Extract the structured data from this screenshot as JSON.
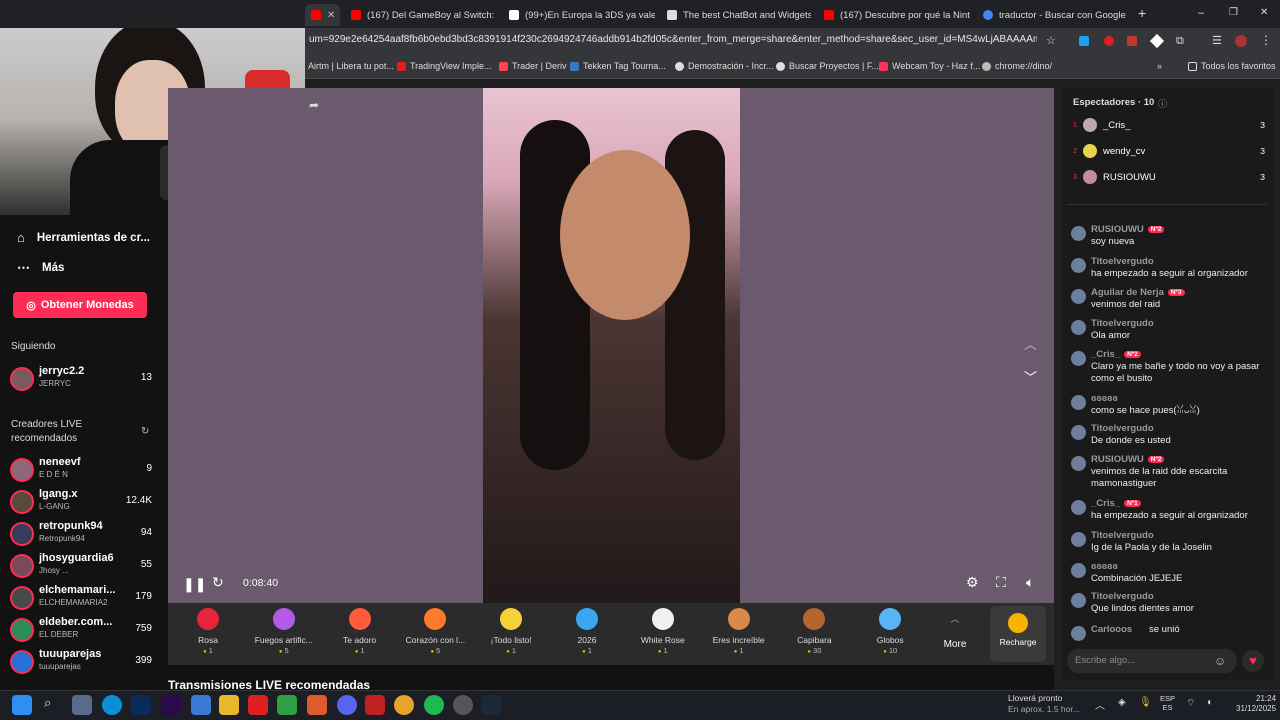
{
  "tabs": [
    {
      "label": "(167) Del GameBoy al Switch: L",
      "color": "#ff0000"
    },
    {
      "label": "(99+)En Europa la 3DS ya vale",
      "color": "#ffffff"
    },
    {
      "label": "The best ChatBot and Widgets",
      "color": "#dddddd"
    },
    {
      "label": "(167) Descubre por qué la Nint",
      "color": "#ff0000"
    },
    {
      "label": "traductor - Buscar con Google",
      "color": "#4285f4"
    }
  ],
  "new_tab": "+",
  "url": "um=929e2e64254aaf8fb6b0ebd3bd3c8391914f230c2694924746addb914b2fd05c&enter_from_merge=share&enter_method=share&sec_user_id=MS4wLjABAAAAmqRN1Wqw7...",
  "bookmarks": [
    {
      "label": "Airtm | Libera tu pot...",
      "color": "#4a6cf7"
    },
    {
      "label": "TradingView Imple...",
      "color": "#e02020"
    },
    {
      "label": "Trader | Deriv",
      "color": "#ff444f"
    },
    {
      "label": "Tekken Tag Tourna...",
      "color": "#3a78c2"
    },
    {
      "label": "Demostración - Incr...",
      "color": "#dddddd"
    },
    {
      "label": "Buscar Proyectos | F...",
      "color": "#dddddd"
    },
    {
      "label": "Webcam Toy - Haz f...",
      "color": "#ff3355"
    },
    {
      "label": "chrome://dino/",
      "color": "#bbbbbb"
    }
  ],
  "bookmarks_all": "Todos los favoritos",
  "sidebar": {
    "tools": "Herramientas de cr...",
    "more": "Más",
    "coins_button": "Obtener Monedas",
    "following_title": "Siguiendo",
    "following": [
      {
        "name": "jerryc2.2",
        "sub": "JERRYC",
        "count": "13"
      }
    ],
    "recommended_title_1": "Creadores LIVE",
    "recommended_title_2": "recomendados",
    "recommended": [
      {
        "name": "neneevf",
        "sub": "E D É N",
        "count": "9"
      },
      {
        "name": "lgang.x",
        "sub": "L-GANG",
        "count": "12.4K"
      },
      {
        "name": "retropunk94",
        "sub": "Retropunk94",
        "count": "94"
      },
      {
        "name": "jhosyguardia6",
        "sub": "Jhosy ...",
        "count": "55"
      },
      {
        "name": "elchemamari...",
        "sub": "ELCHEMAMARIA2",
        "count": "179"
      },
      {
        "name": "eldeber.com...",
        "sub": "EL DEBER",
        "count": "759"
      },
      {
        "name": "tuuuparejas",
        "sub": "tuuuparejas",
        "count": "399"
      }
    ]
  },
  "player": {
    "time": "0:08:40"
  },
  "gifts": [
    {
      "name": "Rosa",
      "price": "1",
      "color": "#e8233b"
    },
    {
      "name": "Fuegos artific...",
      "price": "5",
      "color": "#b45ae8"
    },
    {
      "name": "Te adoro",
      "price": "1",
      "color": "#ff5a3c"
    },
    {
      "name": "Corazón con l...",
      "price": "5",
      "color": "#ff7a2a"
    },
    {
      "name": "¡Todo listo!",
      "price": "1",
      "color": "#f5d13a"
    },
    {
      "name": "2026",
      "price": "1",
      "color": "#3aa7f5"
    },
    {
      "name": "White Rose",
      "price": "1",
      "color": "#f0f0f0"
    },
    {
      "name": "Eres increíble",
      "price": "1",
      "color": "#d88a4a"
    },
    {
      "name": "Capibara",
      "price": "30",
      "color": "#b5652e"
    },
    {
      "name": "Globos",
      "price": "10",
      "color": "#5ab3f5"
    }
  ],
  "gifts_more": "More",
  "recharge": "Recharge",
  "below_title": "Transmisiones LIVE recomendadas",
  "viewers": {
    "title": "Espectadores · 10",
    "list": [
      {
        "rank": "1",
        "name": "_Cris_",
        "score": "3",
        "color": "#bfa8a8"
      },
      {
        "rank": "2",
        "name": "wendy_cv",
        "score": "3",
        "color": "#e6d34a"
      },
      {
        "rank": "3",
        "name": "RUSIOUWU",
        "score": "3",
        "color": "#c48aa0"
      }
    ]
  },
  "chat": [
    {
      "user": "RUSIOUWU",
      "badge": "Nº2",
      "text": "soy nueva"
    },
    {
      "user": "Titoelvergudo",
      "badge": "",
      "text": "ha empezado a seguir al organizador"
    },
    {
      "user": "Aguilar de Nerja",
      "badge": "Nº3",
      "text": "venimos del raid"
    },
    {
      "user": "Titoelvergudo",
      "badge": "",
      "text": "Ola amor"
    },
    {
      "user": "_Cris_",
      "badge": "Nº2",
      "text": "Claro ya me bañe y todo no voy a pasar como el busito"
    },
    {
      "user": "ɞɞɞɞɞ",
      "badge": "",
      "text": "como se hace pues(ꈍᴗꈍ)"
    },
    {
      "user": "Titoelvergudo",
      "badge": "",
      "text": "De donde es usted"
    },
    {
      "user": "RUSIOUWU",
      "badge": "Nº2",
      "text": "venimos de la raid dde escarcita mamonastiguer"
    },
    {
      "user": "_Cris_",
      "badge": "Nº1",
      "text": "ha empezado a seguir al organizador"
    },
    {
      "user": "Titoelvergudo",
      "badge": "",
      "text": "Ig de la Paola y de la Joselin"
    },
    {
      "user": "ɞɞɞɞɞ",
      "badge": "",
      "text": "Combinación JEJEJE"
    },
    {
      "user": "Titoelvergudo",
      "badge": "",
      "text": "Que lindos dientes amor"
    },
    {
      "user": "Carlooos",
      "badge": "",
      "text": "se unió"
    }
  ],
  "chat_placeholder": "Escribe algo...",
  "taskbar": {
    "weather_1": "Lloverá pronto",
    "weather_2": "En aprox. 1.5 hor...",
    "lang_1": "ESP",
    "lang_2": "ES",
    "time": "21:24",
    "date": "31/12/2025"
  }
}
